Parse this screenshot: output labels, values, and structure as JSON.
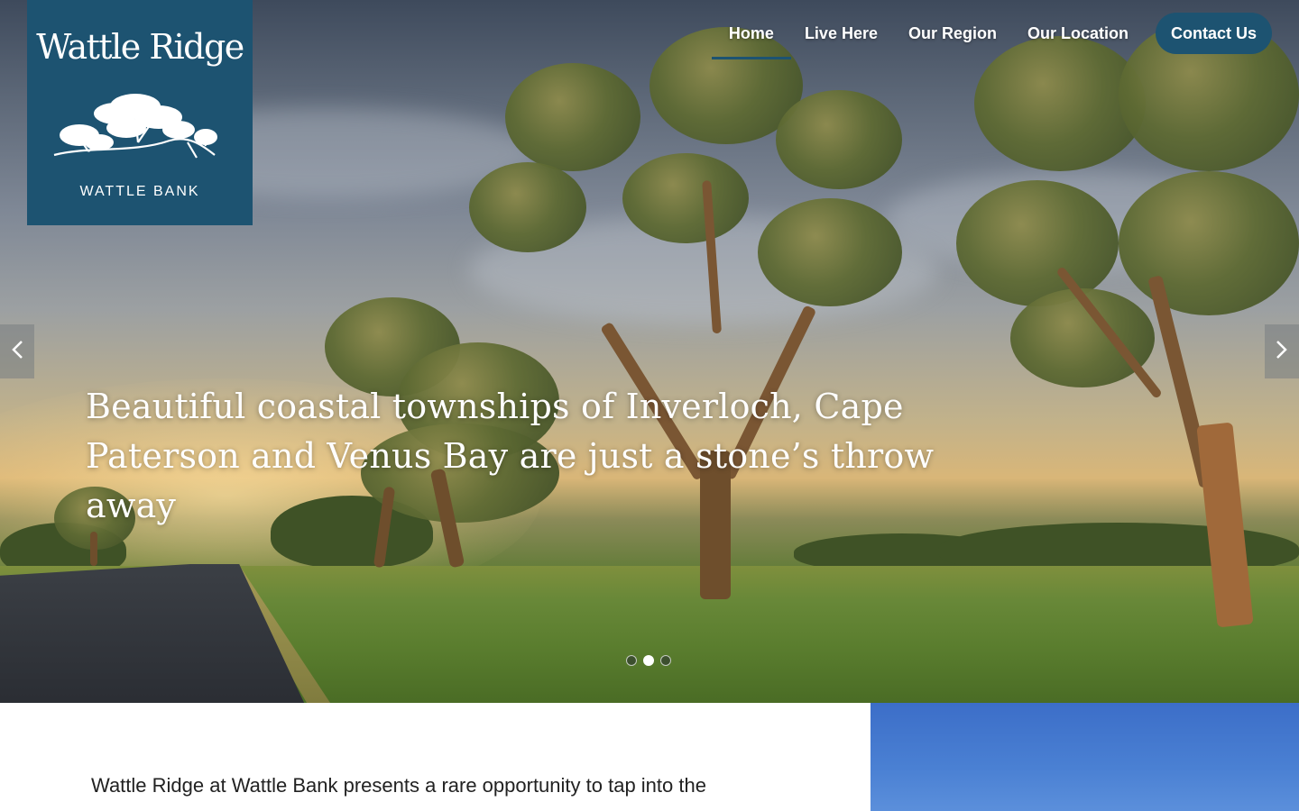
{
  "logo": {
    "title": "Wattle Ridge",
    "subtitle": "WATTLE BANK",
    "graphic_icon": "gum-tree-icon"
  },
  "nav": {
    "items": [
      {
        "label": "Home",
        "active": true
      },
      {
        "label": "Live Here",
        "active": false
      },
      {
        "label": "Our Region",
        "active": false
      },
      {
        "label": "Our Location",
        "active": false
      }
    ],
    "cta_label": "Contact Us"
  },
  "hero": {
    "caption": "Beautiful coastal townships of Inverloch, Cape Paterson and Venus Bay are just a stone’s throw away",
    "prev_icon": "chevron-left-icon",
    "next_icon": "chevron-right-icon",
    "slide_count": 3,
    "active_slide": 2
  },
  "intro": {
    "text": "Wattle Ridge at Wattle Bank presents a rare opportunity to tap into the"
  },
  "colors": {
    "brand": "#1d5371",
    "text_dark": "#222222",
    "sky_blue": "#4a80d3"
  }
}
